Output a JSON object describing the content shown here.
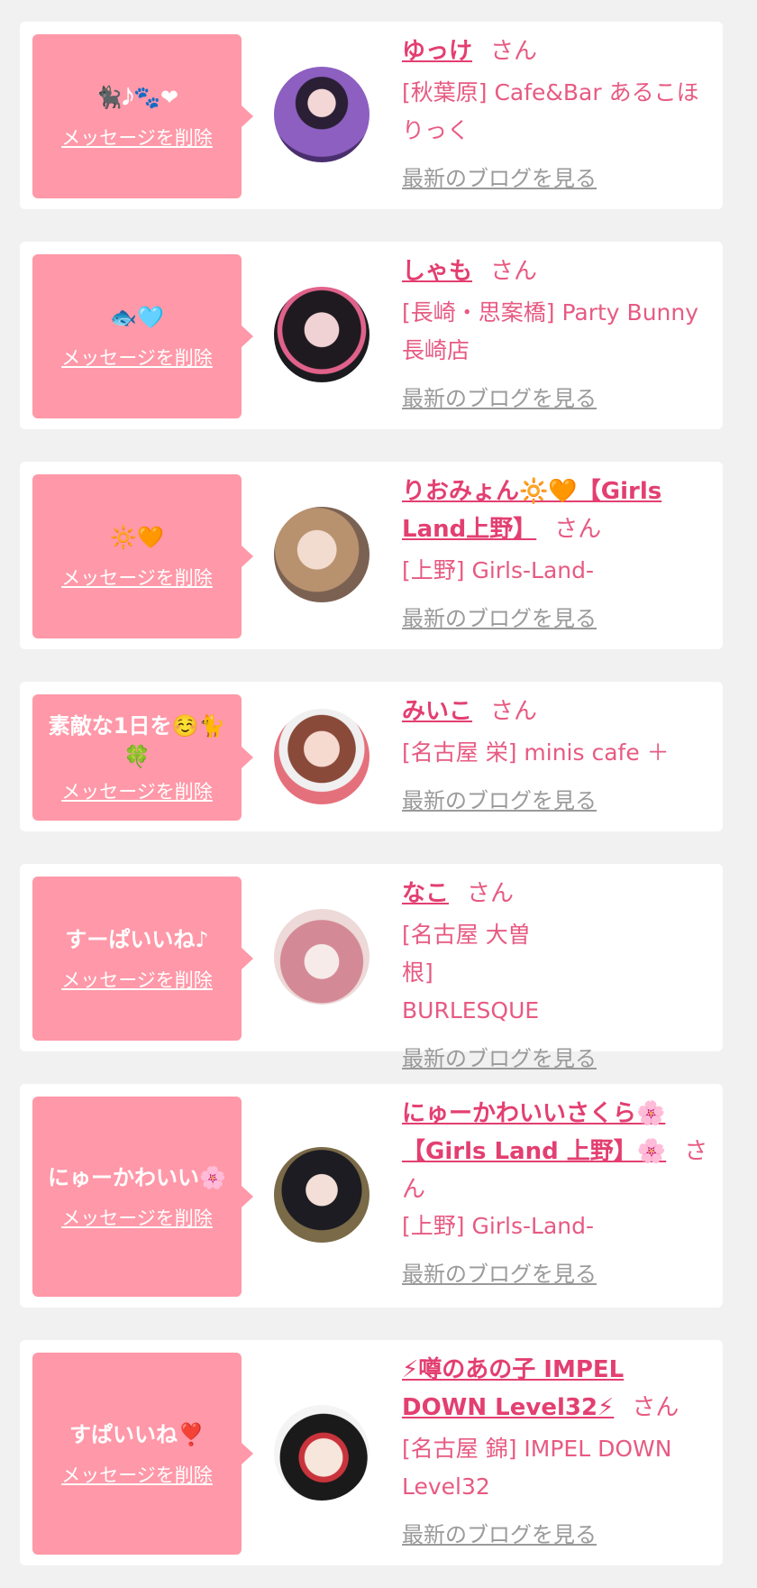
{
  "cards": [
    {
      "message": "🐈‍⬛𝅘𝅥𝅮🐾❤",
      "delete_label": "メッセージを削除",
      "name": "ゆっけ",
      "san": "さん",
      "shop": "[秋葉原] Cafe&Bar あるこほりっく",
      "blog_label": "最新のブログを見る",
      "avatar_color": "#6c4b8e"
    },
    {
      "message": "🐟🩵",
      "delete_label": "メッセージを削除",
      "name": "しゃも",
      "san": "さん",
      "shop": "[長崎・思案橋] Party Bunny 長崎店",
      "blog_label": "最新のブログを見る",
      "avatar_color": "#3a2a2e"
    },
    {
      "message": "🔆🧡",
      "delete_label": "メッセージを削除",
      "name": "りおみょん🔆🧡【Girls Land上野】",
      "san": "さん",
      "shop": "[上野] Girls-Land-",
      "blog_label": "最新のブログを見る",
      "avatar_color": "#c8a894"
    },
    {
      "message": "素敵な1日を☺️🐈🍀",
      "delete_label": "メッセージを削除",
      "name": "みいこ",
      "san": "さん",
      "shop": "[名古屋 栄] minis cafe ＋",
      "blog_label": "最新のブログを見る",
      "avatar_color": "#d9707c"
    },
    {
      "message": "すーぱいいね♪",
      "delete_label": "メッセージを削除",
      "name": "なこ",
      "san": "さん",
      "shop": "[名古屋 大曽根] BURLESQUE",
      "blog_label": "最新のブログを見る",
      "avatar_color": "#d6a6ad"
    },
    {
      "message": "にゅーかわいい🌸",
      "delete_label": "メッセージを削除",
      "name": "にゅーかわいいさくら🌸【Girls Land 上野】🌸",
      "san": "さん",
      "shop": "[上野] Girls-Land-",
      "blog_label": "最新のブログを見る",
      "avatar_color": "#2b2b30"
    },
    {
      "message": "すぱいいね❣️",
      "delete_label": "メッセージを削除",
      "name": "⚡噂のあの子 IMPEL DOWN Level32⚡",
      "san": "さん",
      "shop": "[名古屋 錦] IMPEL DOWN Level32",
      "blog_label": "最新のブログを見る",
      "avatar_color": "#c9343c"
    }
  ]
}
